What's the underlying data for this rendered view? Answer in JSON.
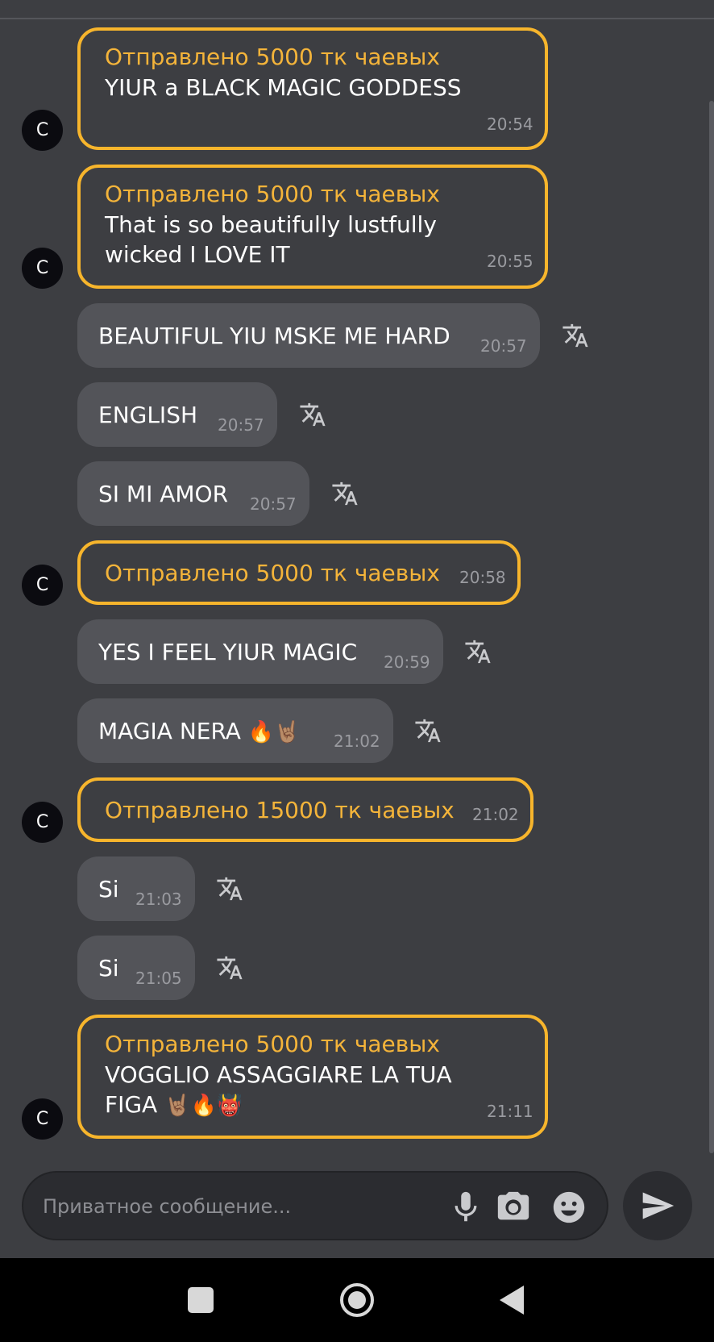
{
  "avatar_letter": "C",
  "tip_color": "#f7b52c",
  "messages": [
    {
      "type": "tip",
      "tip": "Отправлено 5000 тк чаевых",
      "text": "YIUR a BLACK MAGIC GODDESS",
      "time": "20:54"
    },
    {
      "type": "tip",
      "tip": "Отправлено 5000 тк чаевых",
      "text_line1": "That is so beautifully lustfully",
      "text_line2": "wicked I LOVE IT",
      "time": "20:55"
    },
    {
      "type": "text",
      "text": "BEAUTIFUL YIU MSKE ME HARD",
      "time": "20:57"
    },
    {
      "type": "text",
      "text": "ENGLISH",
      "time": "20:57"
    },
    {
      "type": "text",
      "text": "SI MI AMOR",
      "time": "20:57"
    },
    {
      "type": "tip",
      "tip": "Отправлено 5000 тк чаевых",
      "time": "20:58"
    },
    {
      "type": "text",
      "text": "YES I FEEL YIUR MAGIC",
      "time": "20:59"
    },
    {
      "type": "text",
      "text": "MAGIA NERA",
      "emoji": "🔥🤘🏽",
      "time": "21:02"
    },
    {
      "type": "tip",
      "tip": "Отправлено 15000 тк чаевых",
      "time": "21:02"
    },
    {
      "type": "text",
      "text": "Si",
      "time": "21:03"
    },
    {
      "type": "text",
      "text": "Si",
      "time": "21:05"
    },
    {
      "type": "tip",
      "tip": "Отправлено 5000 тк чаевых",
      "text_line1": "VOGGLIO ASSAGGIARE LA TUA",
      "text_line2": "FIGA",
      "emoji": "🤘🏽🔥👹",
      "time": "21:11"
    }
  ],
  "input": {
    "placeholder": "Приватное сообщение...",
    "value": ""
  },
  "icons": {
    "translate": "translate-icon",
    "mic": "microphone-icon",
    "camera": "camera-icon",
    "emoji": "emoji-icon",
    "send": "send-icon",
    "nav_recents": "square-icon",
    "nav_home": "circle-icon",
    "nav_back": "triangle-back-icon"
  }
}
